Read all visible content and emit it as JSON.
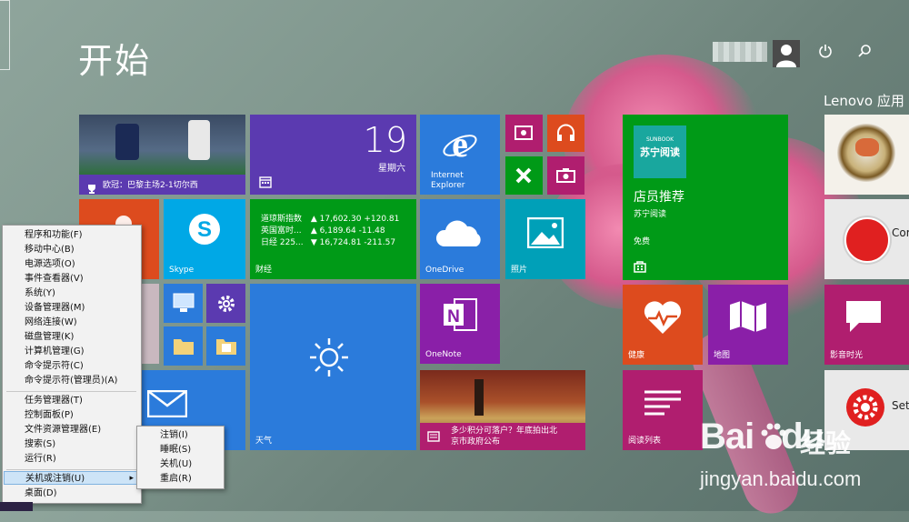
{
  "header": {
    "title": "开始",
    "power_icon": "power-icon",
    "search_icon": "search-icon"
  },
  "group2_title": "Lenovo 应用",
  "tiles": {
    "sports": {
      "headline": "欧冠：巴黎主场2-1切尔西"
    },
    "calendar": {
      "day": "19",
      "weekday": "星期六"
    },
    "ie": {
      "label_line1": "Internet",
      "label_line2": "Explorer"
    },
    "skype": {
      "label": "Skype"
    },
    "finance": {
      "label": "财经",
      "rows": [
        {
          "name": "道琼斯指数",
          "v1": "▲ 17,602.30",
          "v2": "+120.81"
        },
        {
          "name": "英国富时...",
          "v1": "▲ 6,189.64",
          "v2": "-11.48"
        },
        {
          "name": "日经 225...",
          "v1": "▼ 16,724.81",
          "v2": "-211.57"
        }
      ]
    },
    "onedrive": {
      "label": "OneDrive"
    },
    "photos": {
      "label": "照片"
    },
    "weather": {
      "label": "天气"
    },
    "onenote": {
      "label": "OneNote"
    },
    "news": {
      "headline_line1": "多少积分可落户？年底拍出北",
      "headline_line2": "京市政府公布"
    },
    "store": {
      "title": "店员推荐",
      "app": "苏宁阅读",
      "price": "免费",
      "logo_line1": "SUNBOOK",
      "logo_line2": "苏宁阅读"
    },
    "health": {
      "label": "健康"
    },
    "maps": {
      "label": "地图"
    },
    "reading": {
      "label": "阅读列表"
    },
    "video": {
      "label": "影音时光"
    },
    "partial1": {
      "label": "Cor"
    },
    "partial2": {
      "label": "Sett"
    }
  },
  "context_menu": {
    "items": [
      "程序和功能(F)",
      "移动中心(B)",
      "电源选项(O)",
      "事件查看器(V)",
      "系统(Y)",
      "设备管理器(M)",
      "网络连接(W)",
      "磁盘管理(K)",
      "计算机管理(G)",
      "命令提示符(C)",
      "命令提示符(管理员)(A)",
      "任务管理器(T)",
      "控制面板(P)",
      "文件资源管理器(E)",
      "搜索(S)",
      "运行(R)",
      "关机或注销(U)",
      "桌面(D)"
    ],
    "submenu_arrow": "▸",
    "submenu": [
      "注销(I)",
      "睡眠(S)",
      "关机(U)",
      "重启(R)"
    ]
  },
  "watermark": {
    "brand": "Bai",
    "brand2": "du",
    "cn": "经验",
    "url": "jingyan.baidu.com"
  },
  "colors": {
    "purple_tile": "#5b3ab0",
    "green_tile": "#009a17",
    "blue_tile": "#2b7bdb",
    "cyan_tile": "#00a8e6",
    "magenta_tile": "#b01e6f",
    "orange_tile": "#dd4b1e",
    "violet_tile": "#8a1fa8"
  }
}
